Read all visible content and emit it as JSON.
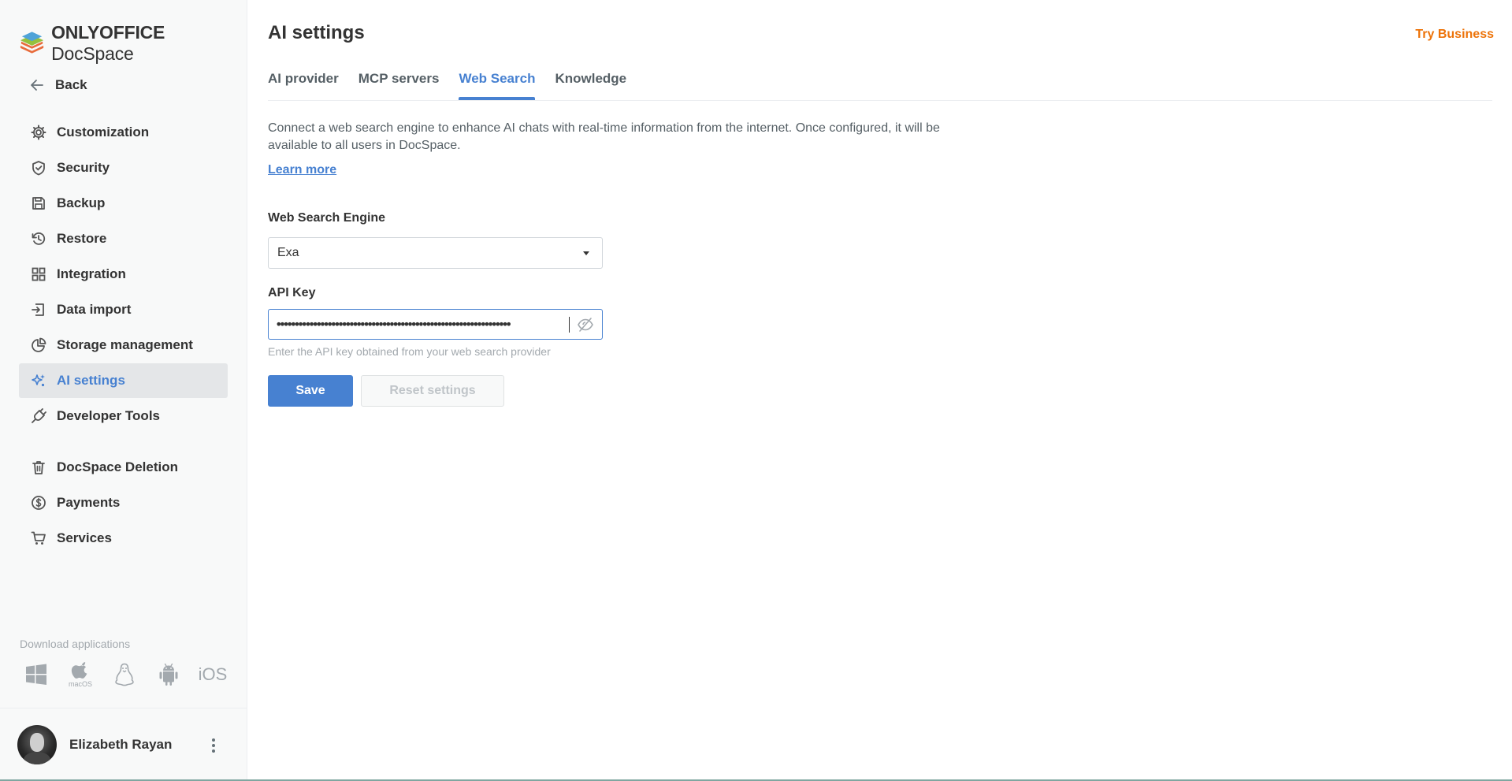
{
  "brand": {
    "name_bold": "ONLYOFFICE",
    "name_regular": "DocSpace",
    "logo_colors": [
      "#e86b3b",
      "#95c13d",
      "#4fa3d8"
    ]
  },
  "sidebar": {
    "back_label": "Back",
    "items": [
      {
        "label": "Customization",
        "icon": "gear-icon",
        "active": false
      },
      {
        "label": "Security",
        "icon": "shield-icon",
        "active": false
      },
      {
        "label": "Backup",
        "icon": "floppy-icon",
        "active": false
      },
      {
        "label": "Restore",
        "icon": "history-icon",
        "active": false
      },
      {
        "label": "Integration",
        "icon": "grid-icon",
        "active": false
      },
      {
        "label": "Data import",
        "icon": "import-icon",
        "active": false
      },
      {
        "label": "Storage management",
        "icon": "pie-chart-icon",
        "active": false
      },
      {
        "label": "AI settings",
        "icon": "ai-sparkle-icon",
        "active": true
      },
      {
        "label": "Developer Tools",
        "icon": "plug-icon",
        "active": false
      },
      {
        "label": "DocSpace Deletion",
        "icon": "trash-icon",
        "active": false
      },
      {
        "label": "Payments",
        "icon": "coin-icon",
        "active": false
      },
      {
        "label": "Services",
        "icon": "cart-icon",
        "active": false
      }
    ],
    "download_title": "Download applications",
    "apps": [
      {
        "name": "windows-icon",
        "caption": ""
      },
      {
        "name": "apple-icon",
        "caption": "macOS"
      },
      {
        "name": "linux-icon",
        "caption": ""
      },
      {
        "name": "android-icon",
        "caption": ""
      },
      {
        "name": "ios-icon",
        "caption": "iOS"
      }
    ]
  },
  "user": {
    "name": "Elizabeth Rayan"
  },
  "header": {
    "title": "AI settings",
    "try_business": "Try Business"
  },
  "tabs": [
    {
      "label": "AI provider",
      "active": false
    },
    {
      "label": "MCP servers",
      "active": false
    },
    {
      "label": "Web Search",
      "active": true
    },
    {
      "label": "Knowledge",
      "active": false
    }
  ],
  "content": {
    "description": "Connect a web search engine to enhance AI chats with real-time information from the internet. Once configured, it will be available to all users in DocSpace.",
    "learn_more": "Learn more",
    "engine_label": "Web Search Engine",
    "engine_value": "Exa",
    "api_key_label": "API Key",
    "api_key_value": "••••••••••••••••••••••••••••••••••••••••••••••••••••••••••••••••",
    "api_key_hint": "Enter the API key obtained from your web search provider",
    "save_label": "Save",
    "reset_label": "Reset settings"
  },
  "colors": {
    "accent": "#4781d1",
    "business": "#ed7309",
    "sidebar_bg": "#f8f9f9",
    "active_bg": "#e4e6e8"
  }
}
